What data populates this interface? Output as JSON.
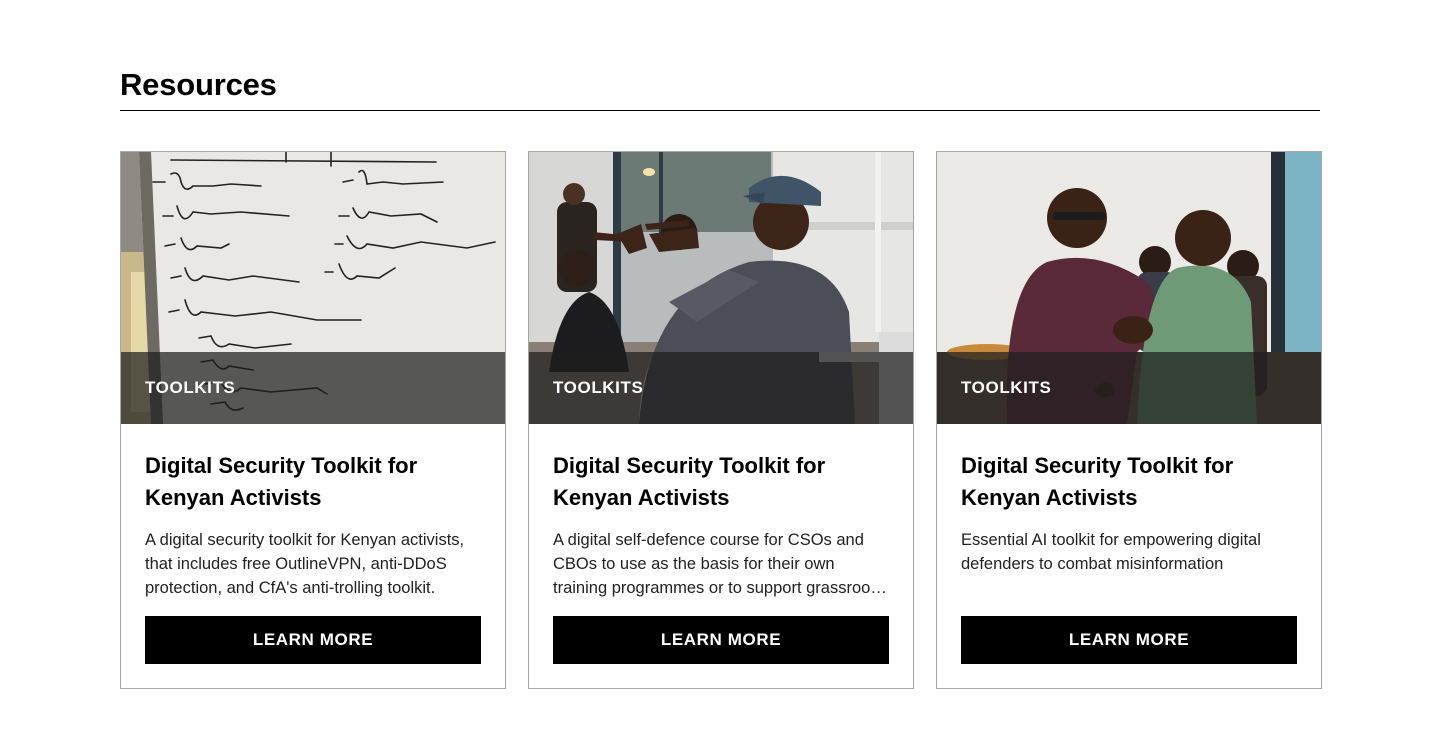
{
  "section": {
    "title": "Resources"
  },
  "cards": [
    {
      "tag": "TOOLKITS",
      "title": "Digital Security Toolkit for Kenyan Activists",
      "description": "A digital security toolkit for Kenyan activists, that includes free OutlineVPN, anti-DDoS protection, and CfA's anti-trolling toolkit.",
      "button": "LEARN MORE",
      "image": "whiteboard with handwritten notes"
    },
    {
      "tag": "TOOLKITS",
      "title": "Digital Security Toolkit for Kenyan Activists",
      "description": "A digital self-defence course for CSOs and CBOs to use as the basis for their own training programmes or to support grassroots activists.",
      "button": "LEARN MORE",
      "image": "man in cap pointing during workshop"
    },
    {
      "tag": "TOOLKITS",
      "title": "Digital Security Toolkit for Kenyan Activists",
      "description": "Essential AI toolkit for empowering digital defenders to combat misinformation",
      "button": "LEARN MORE",
      "image": "two men greeting with handshake"
    }
  ],
  "colors": {
    "button_bg": "#000000",
    "button_text": "#ffffff",
    "card_border": "#a6a6a6",
    "tag_overlay": "#1e1e1e"
  }
}
